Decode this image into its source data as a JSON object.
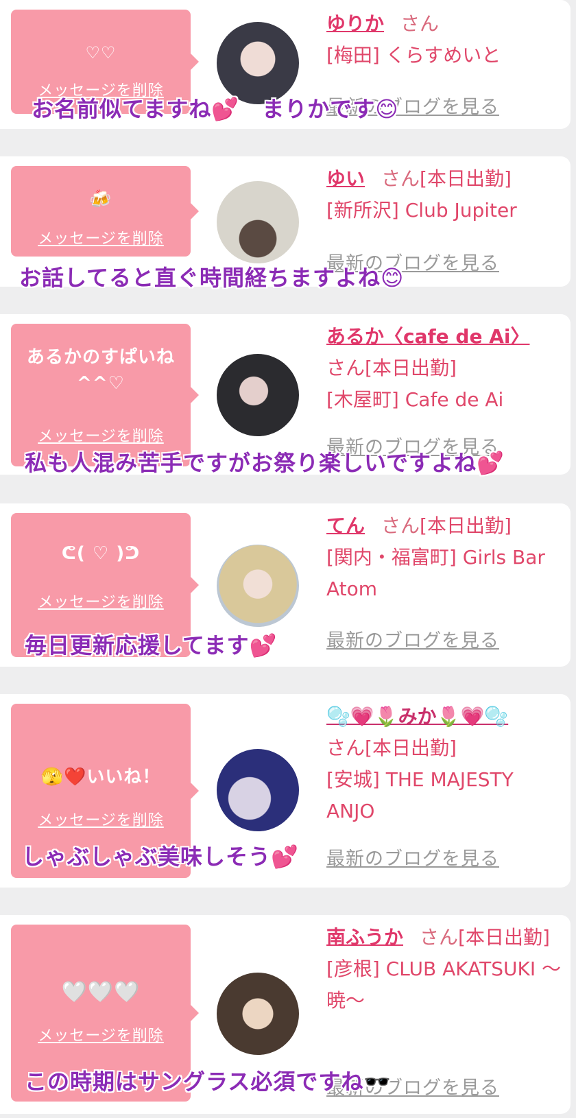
{
  "cards": [
    {
      "bubble_message": "♡♡",
      "delete_label": "メッセージを削除",
      "name": "ゆりか",
      "san": "さん",
      "status": "",
      "shop": "[梅田] くらすめいと",
      "blog_label": "最新のブログを見る",
      "caption": "お名前似てますね💕　まりかです😊",
      "avatar_colors": [
        "#3a3a46",
        "#e9d6d2"
      ]
    },
    {
      "bubble_message": "🍻",
      "delete_label": "メッセージを削除",
      "name": "ゆい",
      "san": "さん",
      "status": "[本日出勤]",
      "shop": "[新所沢] Club Jupiter",
      "blog_label": "最新のブログを見る",
      "caption": "お話してると直ぐ時間経ちますよね😊",
      "avatar_colors": [
        "#d8d5cc",
        "#6e5d53"
      ]
    },
    {
      "bubble_message": "あるかのすぱいね ^^♡",
      "delete_label": "メッセージを削除",
      "name": "あるか〈cafe de Ai〉",
      "san": "さん",
      "status": "[本日出勤]",
      "shop": "[木屋町] Cafe de Ai",
      "blog_label": "最新のブログを見る",
      "caption": "私も人混み苦手ですがお祭り楽しいですよね💕",
      "avatar_colors": [
        "#2b2b2f",
        "#d9c4c4"
      ]
    },
    {
      "bubble_message": "ᕦ( ♡ )ᕤ",
      "delete_label": "メッセージを削除",
      "name": "てん",
      "san": "さん",
      "status": "[本日出勤]",
      "shop": "[関内・福富町] Girls Bar Atom",
      "blog_label": "最新のブログを見る",
      "caption": "毎日更新応援してます💕",
      "avatar_colors": [
        "#d9c89a",
        "#bcc7d3"
      ]
    },
    {
      "bubble_message": "🫣❤️いいね！",
      "delete_label": "メッセージを削除",
      "name": "🫧💗🌷みか🌷💗🫧",
      "san": "さん",
      "status": "[本日出勤]",
      "shop": "[安城] THE MAJESTY ANJO",
      "blog_label": "最新のブログを見る",
      "caption": "しゃぶしゃぶ美味しそう💕",
      "avatar_colors": [
        "#2b2f7a",
        "#c8c2d8"
      ]
    },
    {
      "bubble_message": "🤍🤍🤍",
      "delete_label": "メッセージを削除",
      "name": "南ふうか",
      "san": "さん",
      "status": "[本日出勤]",
      "shop": "[彦根] CLUB AKATSUKI 〜暁〜",
      "blog_label": "最新のブログを見る",
      "caption": "この時期はサングラス必須ですね🕶️",
      "avatar_colors": [
        "#4a3a30",
        "#e6cdb6"
      ]
    }
  ]
}
